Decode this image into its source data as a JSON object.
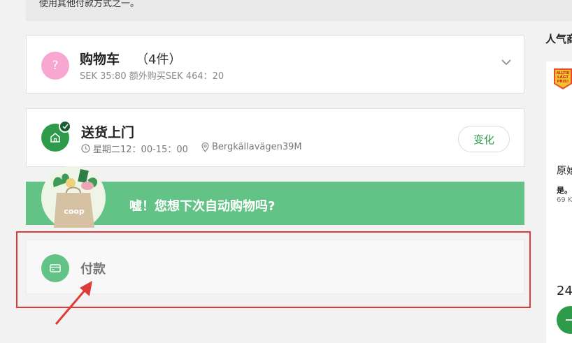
{
  "notice": {
    "text": "使用其他付款方式之一。"
  },
  "cart": {
    "icon": "question-icon",
    "icon_glyph": "?",
    "title": "购物车",
    "count": "（4件）",
    "subtitle": "SEK 35:80 额外购买SEK 464：20"
  },
  "delivery": {
    "icon": "home-icon",
    "title": "送货上门",
    "time": "星期二12：00-15：00",
    "address": "Bergkällavägen39M",
    "change_label": "变化"
  },
  "banner": {
    "text": "嘘！您想下次自动购物吗?",
    "bag_text": "coop"
  },
  "payment": {
    "icon": "credit-card-icon",
    "title": "付款"
  },
  "sidebar": {
    "title": "人气商",
    "product": {
      "badge_lines": [
        "ALLTID",
        "LÅGT",
        "PRIS!"
      ],
      "name": "原始",
      "brand": "是。",
      "size": "69 K",
      "price": "24"
    }
  },
  "colors": {
    "green": "#2e9b4b",
    "banner_green": "#63c387",
    "pink": "#f7a7d2",
    "highlight_red": "#e03b3b"
  }
}
